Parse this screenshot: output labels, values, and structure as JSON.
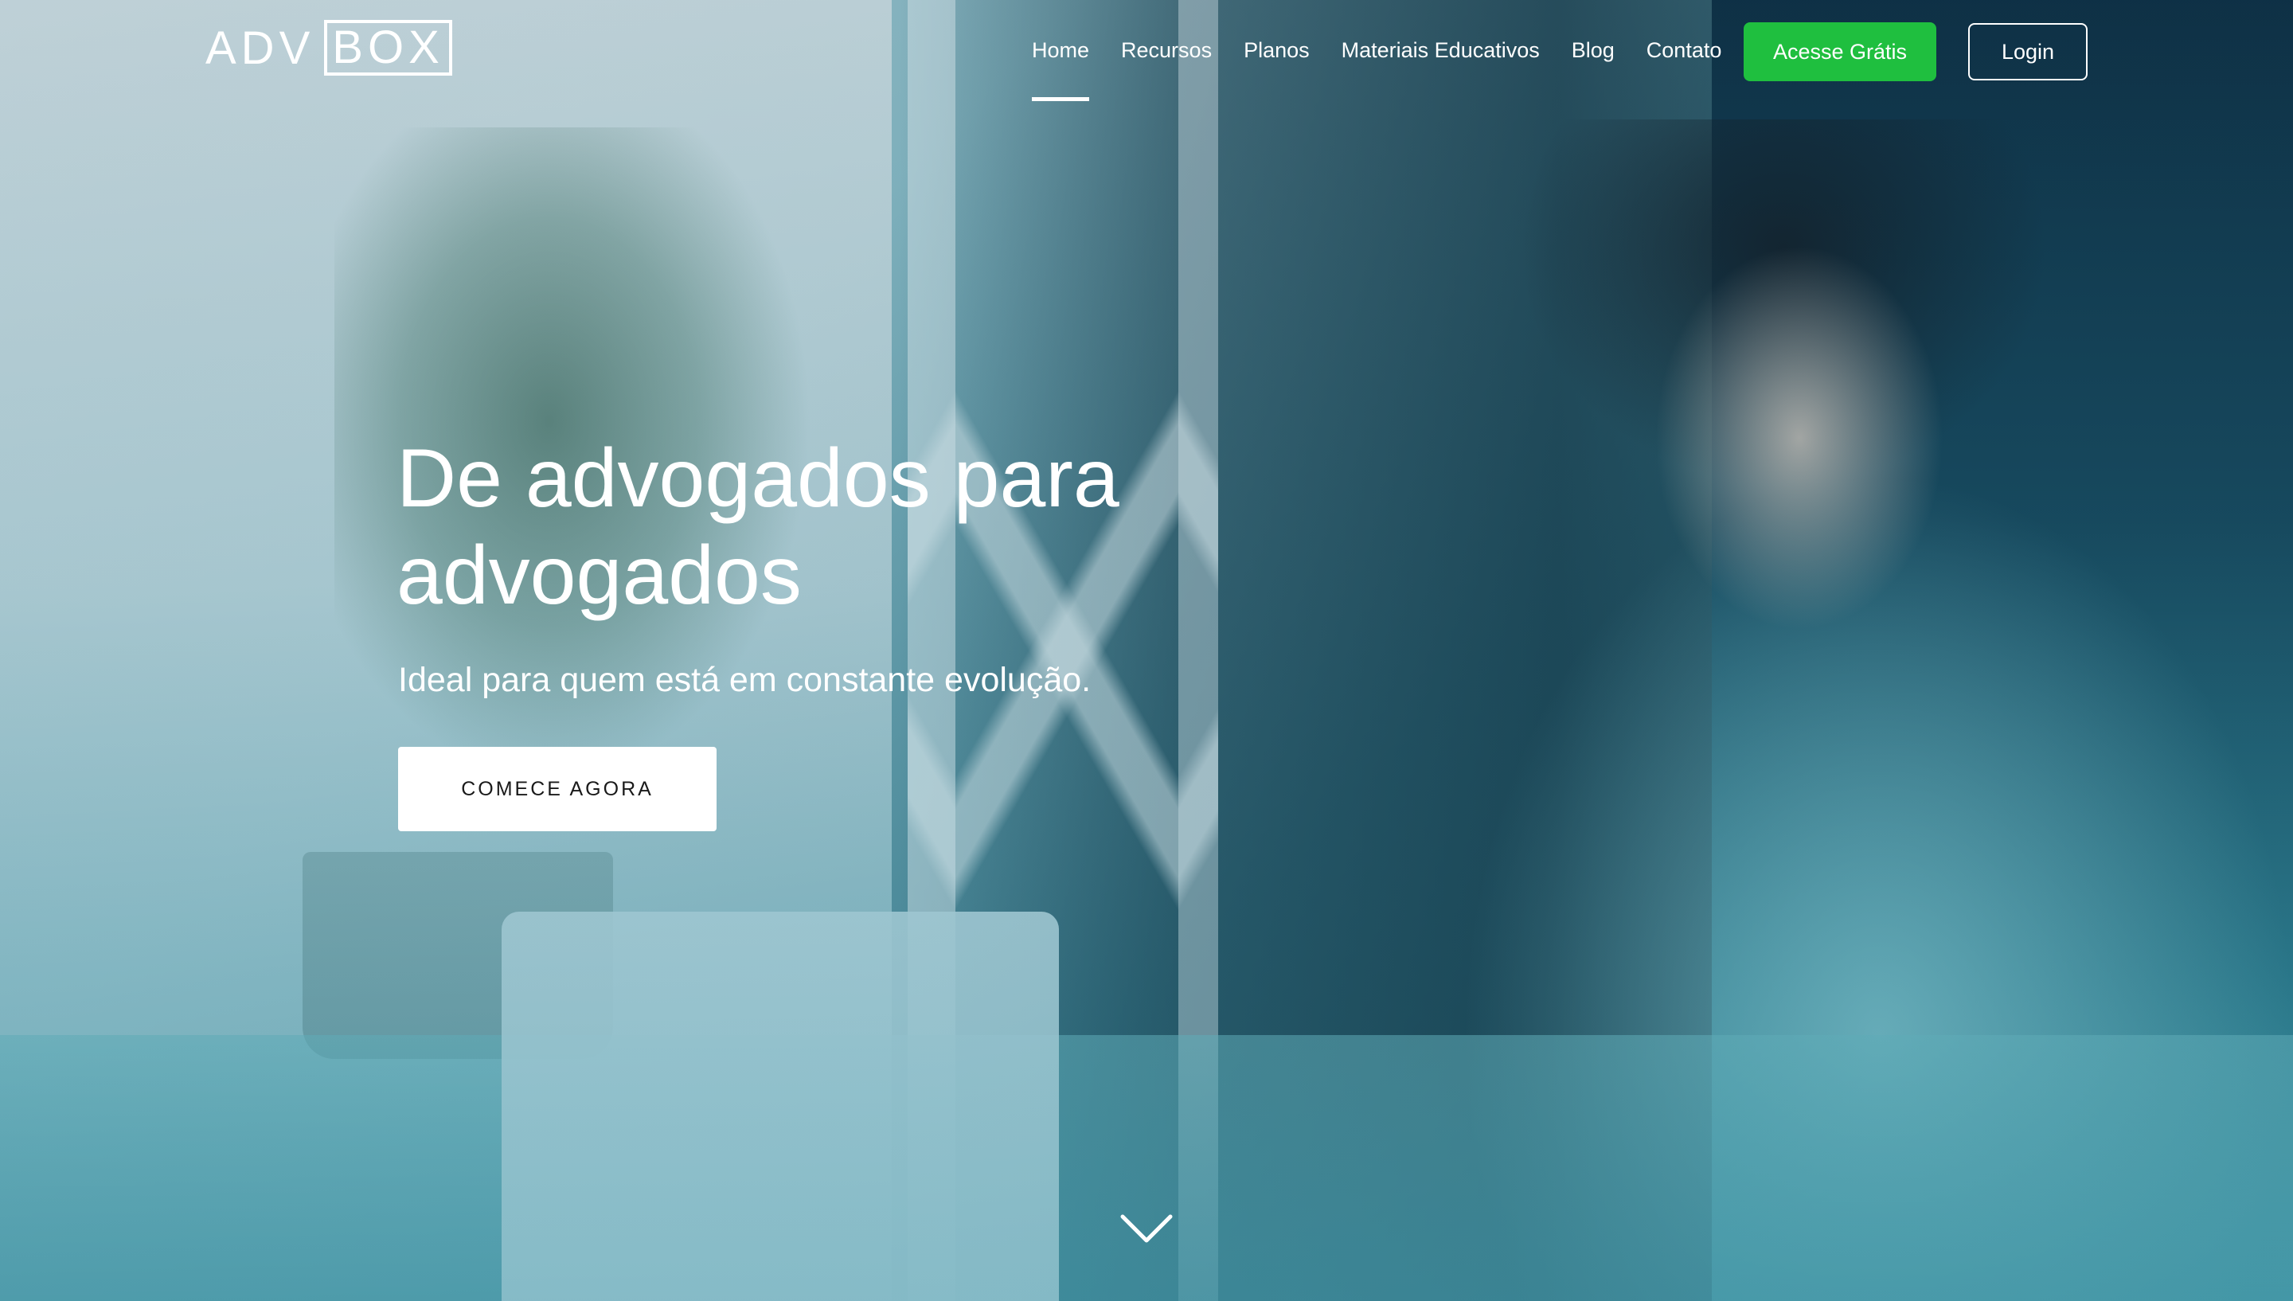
{
  "logo": {
    "part1": "ADV",
    "part2": "BOX"
  },
  "nav": {
    "items": [
      {
        "label": "Home",
        "active": true
      },
      {
        "label": "Recursos",
        "active": false
      },
      {
        "label": "Planos",
        "active": false
      },
      {
        "label": "Materiais Educativos",
        "active": false
      },
      {
        "label": "Blog",
        "active": false
      },
      {
        "label": "Contato",
        "active": false
      }
    ],
    "cta_label": "Acesse Grátis",
    "login_label": "Login"
  },
  "hero": {
    "headline": "De advogados para advogados",
    "subheadline": "Ideal para quem está em constante evolução.",
    "cta_label": "COMECE AGORA",
    "scroll_icon": "chevron-down-icon"
  },
  "colors": {
    "accent_green": "#1fbf3f",
    "text": "#ffffff",
    "cta_bg": "#ffffff",
    "cta_text": "#1a1a1a"
  }
}
